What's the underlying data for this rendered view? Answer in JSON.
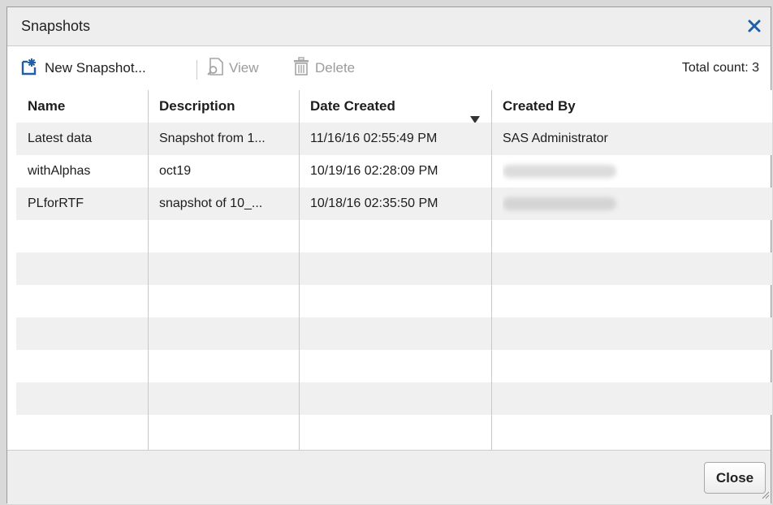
{
  "dialog": {
    "title": "Snapshots",
    "close_icon": "close-icon"
  },
  "toolbar": {
    "new_snapshot_label": "New Snapshot...",
    "view_label": "View",
    "delete_label": "Delete",
    "total_count": "Total count: 3",
    "icons": [
      "new-snapshot-icon",
      "view-icon",
      "delete-icon"
    ]
  },
  "table": {
    "columns": [
      {
        "label": "Name"
      },
      {
        "label": "Description"
      },
      {
        "label": "Date Created",
        "sort": "descending"
      },
      {
        "label": "Created By"
      }
    ],
    "rows": [
      {
        "name": "Latest data",
        "description": "Snapshot from 1...",
        "date_created": "11/16/16 02:55:49 PM",
        "created_by": "SAS Administrator"
      },
      {
        "name": "withAlphas",
        "description": "oct19",
        "date_created": "10/19/16 02:28:09 PM",
        "created_by": ""
      },
      {
        "name": "PLforRTF",
        "description": "snapshot of 10_...",
        "date_created": "10/18/16 02:35:50 PM",
        "created_by": ""
      }
    ]
  },
  "footer": {
    "close_label": "Close"
  },
  "colors": {
    "accent_blue": "#1f5fa8",
    "alt_row": "#f0f0f0",
    "disabled_text": "#9c9c9c"
  }
}
